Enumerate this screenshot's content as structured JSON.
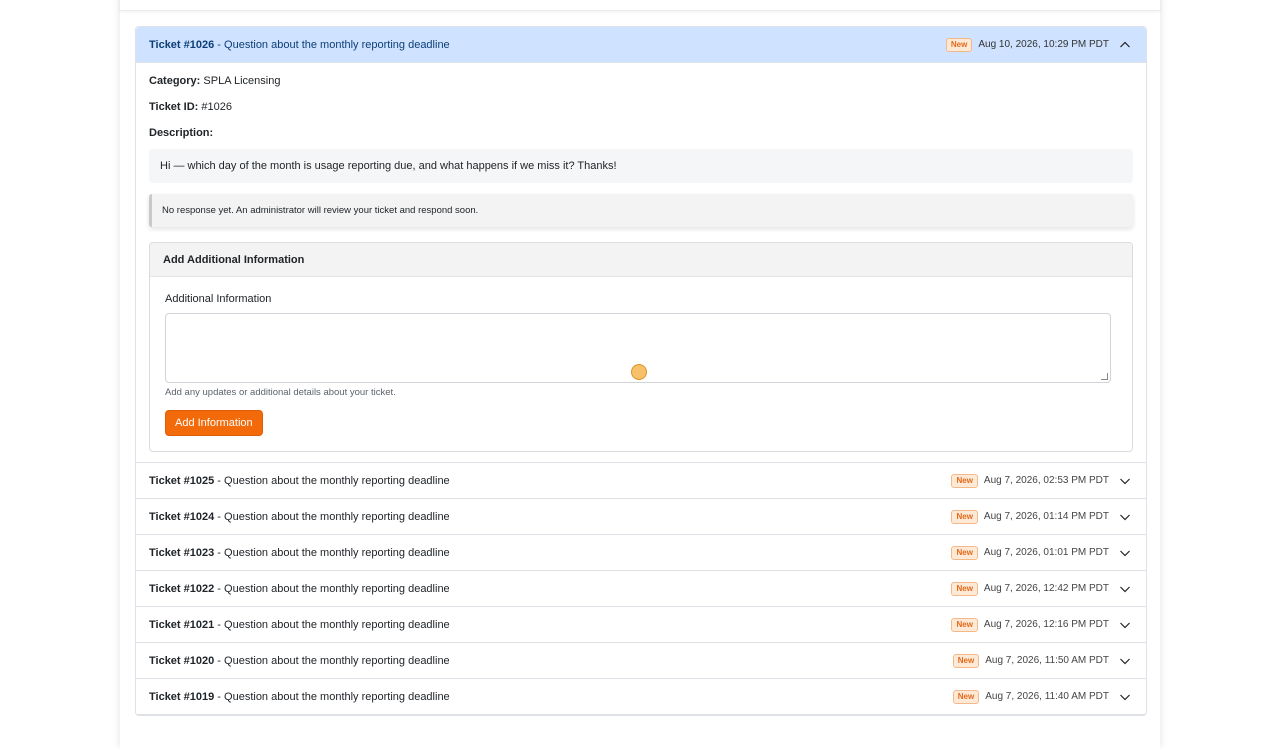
{
  "open_ticket": {
    "id_label": "Ticket #1026",
    "subject": " - Question about the monthly reporting deadline",
    "status": "New",
    "timestamp": "Aug 10, 2026, 10:29 PM PDT",
    "category_label": "Category:",
    "category_value": " SPLA Licensing",
    "ticket_id_label": "Ticket ID:",
    "ticket_id_value": " #1026",
    "description_label": "Description:",
    "description": "Hi — which day of the month is usage reporting due, and what happens if we miss it? Thanks!",
    "response": "No response yet. An administrator will review your ticket and respond soon.",
    "add_info": {
      "card_title": "Add Additional Information",
      "field_label": "Additional Information",
      "field_value": "",
      "help_text": "Add any updates or additional details about your ticket.",
      "button_label": "Add Information"
    }
  },
  "tickets": [
    {
      "id_label": "Ticket #1025",
      "subject": " - Question about the monthly reporting deadline",
      "status": "New",
      "timestamp": "Aug 7, 2026, 02:53 PM PDT"
    },
    {
      "id_label": "Ticket #1024",
      "subject": " - Question about the monthly reporting deadline",
      "status": "New",
      "timestamp": "Aug 7, 2026, 01:14 PM PDT"
    },
    {
      "id_label": "Ticket #1023",
      "subject": " - Question about the monthly reporting deadline",
      "status": "New",
      "timestamp": "Aug 7, 2026, 01:01 PM PDT"
    },
    {
      "id_label": "Ticket #1022",
      "subject": " - Question about the monthly reporting deadline",
      "status": "New",
      "timestamp": "Aug 7, 2026, 12:42 PM PDT"
    },
    {
      "id_label": "Ticket #1021",
      "subject": " - Question about the monthly reporting deadline",
      "status": "New",
      "timestamp": "Aug 7, 2026, 12:16 PM PDT"
    },
    {
      "id_label": "Ticket #1020",
      "subject": " - Question about the monthly reporting deadline",
      "status": "New",
      "timestamp": "Aug 7, 2026, 11:50 AM PDT"
    },
    {
      "id_label": "Ticket #1019",
      "subject": " - Question about the monthly reporting deadline",
      "status": "New",
      "timestamp": "Aug 7, 2026, 11:40 AM PDT"
    }
  ],
  "icons": {
    "expanded": "chevron-up-icon",
    "collapsed": "chevron-down-icon"
  },
  "colors": {
    "open_header_bg": "#cfe2ff",
    "badge_text": "#e36a1a",
    "button_bg": "#f26a0a"
  }
}
